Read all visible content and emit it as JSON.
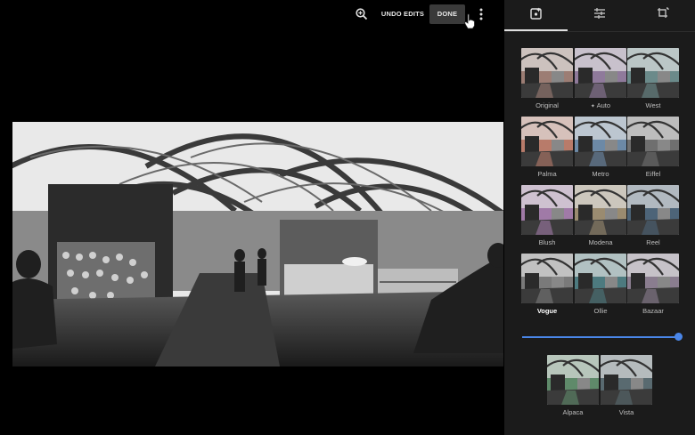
{
  "toolbar": {
    "zoom_icon": "zoom-in-icon",
    "undo_label": "UNDO EDITS",
    "done_label": "DONE",
    "more_icon": "more-vert-icon"
  },
  "photo": {
    "description_icon": "panorama-photo",
    "filter": "grayscale"
  },
  "panel": {
    "tabs": [
      {
        "icon": "photo-filter-icon",
        "selected": true
      },
      {
        "icon": "tune-icon",
        "selected": false
      },
      {
        "icon": "crop-rotate-icon",
        "selected": false
      }
    ],
    "filters": [
      {
        "label": "Original",
        "tint": "#9c7d74"
      },
      {
        "label": "Auto",
        "tint": "#8f7a9b",
        "icon": "auto-fix-icon"
      },
      {
        "label": "West",
        "tint": "#6b8a8a"
      },
      {
        "label": "Palma",
        "tint": "#b87b6a"
      },
      {
        "label": "Metro",
        "tint": "#6c89a6"
      },
      {
        "label": "Eiffel",
        "tint": "#6f6f6f"
      },
      {
        "label": "Blush",
        "tint": "#a07aa7"
      },
      {
        "label": "Modena",
        "tint": "#9a8b70"
      },
      {
        "label": "Reel",
        "tint": "#4d6478"
      },
      {
        "label": "Vogue",
        "tint": "#7a7a7a",
        "selected": true
      },
      {
        "label": "Ollie",
        "tint": "#4d7a7f"
      },
      {
        "label": "Bazaar",
        "tint": "#8a7d8f"
      },
      {
        "label": "Alpaca",
        "tint": "#5f8a6a"
      },
      {
        "label": "Vista",
        "tint": "#596a70"
      }
    ],
    "intensity": 1.0
  },
  "colors": {
    "accent": "#4a86e8",
    "panel_bg": "#1b1b1b",
    "background": "#000000"
  }
}
